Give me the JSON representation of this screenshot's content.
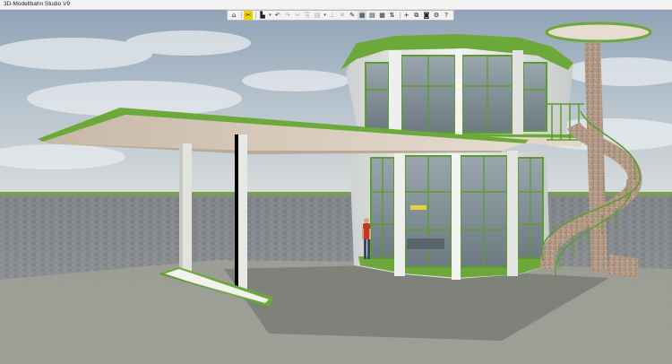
{
  "window": {
    "title": "3D-Modellbahn Studio V9"
  },
  "toolbar": {
    "buttons": [
      {
        "name": "home-button",
        "glyph": "⌂",
        "state": "normal"
      },
      {
        "sep": true
      },
      {
        "name": "edit-mode-button",
        "glyph": "✂",
        "state": "active"
      },
      {
        "sep": true
      },
      {
        "name": "building-button",
        "glyph": "▙",
        "state": "normal"
      },
      {
        "name": "building-menu-caret",
        "glyph": "▾",
        "state": "caret"
      },
      {
        "name": "undo-button",
        "glyph": "↶",
        "state": "normal"
      },
      {
        "name": "redo-button",
        "glyph": "↷",
        "state": "dim"
      },
      {
        "name": "cut-button",
        "glyph": "✂",
        "state": "dim"
      },
      {
        "name": "copy-button",
        "glyph": "⎘",
        "state": "dim"
      },
      {
        "name": "paste-button",
        "glyph": "▤",
        "state": "dim"
      },
      {
        "name": "paste-menu-caret",
        "glyph": "▾",
        "state": "caret"
      },
      {
        "name": "align-button",
        "glyph": "⊥",
        "state": "dim"
      },
      {
        "name": "delete-button",
        "glyph": "✕",
        "state": "dim"
      },
      {
        "name": "tools-button",
        "glyph": "✎",
        "state": "normal"
      },
      {
        "name": "view-3d-button",
        "glyph": "▦",
        "state": "selected"
      },
      {
        "name": "view-layers-button",
        "glyph": "▤",
        "state": "normal"
      },
      {
        "name": "grid-button",
        "glyph": "▦",
        "state": "normal"
      },
      {
        "name": "measure-button",
        "glyph": "⇅",
        "state": "normal"
      },
      {
        "sep": true
      },
      {
        "name": "add-object-button",
        "glyph": "+",
        "state": "normal"
      },
      {
        "name": "catalog-button",
        "glyph": "⧉",
        "state": "normal"
      },
      {
        "name": "camera-button",
        "glyph": "◙",
        "state": "normal"
      },
      {
        "name": "settings-button",
        "glyph": "⚙",
        "state": "normal"
      },
      {
        "name": "help-button",
        "glyph": "?",
        "state": "normal"
      }
    ]
  },
  "scene": {
    "description_colors": {
      "sky": "#b9c3cc",
      "trim_green": "#6ca93a",
      "wall_white": "#e7e7e6",
      "ground": "#8a8d90"
    }
  }
}
